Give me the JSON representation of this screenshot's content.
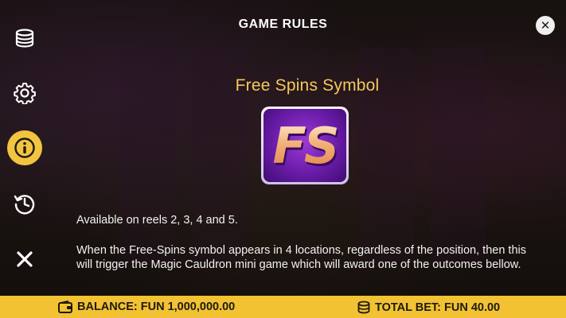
{
  "header": {
    "title": "GAME RULES",
    "close_label": "✕"
  },
  "sidebar": {
    "items": [
      {
        "name": "coins-stack",
        "icon": "coins-stack-icon",
        "active": false
      },
      {
        "name": "settings",
        "icon": "gear-icon",
        "active": false
      },
      {
        "name": "info",
        "icon": "info-icon",
        "active": true
      },
      {
        "name": "history",
        "icon": "history-clock-icon",
        "active": false
      },
      {
        "name": "close",
        "icon": "x-icon",
        "active": false
      }
    ]
  },
  "rules": {
    "section_title": "Free Spins Symbol",
    "symbol_label": "FS",
    "paragraph_1": "Available on reels 2, 3, 4 and 5.",
    "paragraph_2": "When the Free-Spins symbol appears in 4 locations, regardless of the position, then this will trigger the Magic Cauldron mini game which will award one of the outcomes bellow."
  },
  "footer": {
    "balance_text": "BALANCE: FUN 1,000,000.00",
    "total_bet_text": "TOTAL BET: FUN 40.00"
  },
  "colors": {
    "accent": "#f2c232",
    "section_title": "#f4c95a",
    "symbol_purple": "#6a1ca8"
  }
}
